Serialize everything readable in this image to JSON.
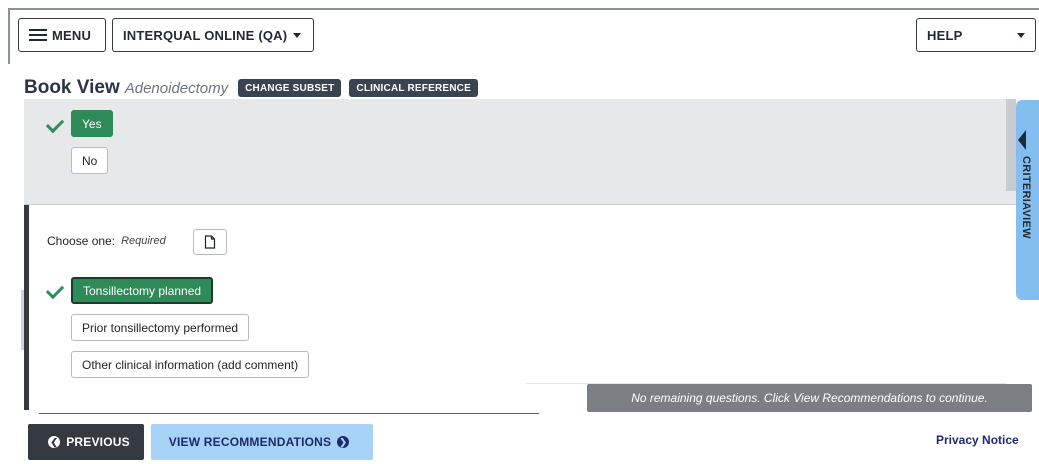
{
  "header": {
    "menu_label": "MENU",
    "product_label": "INTERQUAL ONLINE (QA)",
    "help_label": "HELP"
  },
  "title_row": {
    "title": "Book View",
    "subtitle": "Adenoidectomy",
    "change_subset_label": "CHANGE SUBSET",
    "clinical_reference_label": "CLINICAL REFERENCE"
  },
  "question1": {
    "options": [
      {
        "label": "Yes",
        "selected": true
      },
      {
        "label": "No",
        "selected": false
      }
    ]
  },
  "question2": {
    "prompt": "Choose one:",
    "required_label": "Required",
    "options": [
      {
        "label": "Tonsillectomy planned",
        "selected": true
      },
      {
        "label": "Prior tonsillectomy performed",
        "selected": false
      },
      {
        "label": "Other clinical information (add comment)",
        "selected": false
      }
    ]
  },
  "notice_text": "No remaining questions. Click View Recommendations to continue.",
  "criteria_tab_label": "CRITERIAVIEW",
  "footer": {
    "previous_label": "PREVIOUS",
    "view_recommendations_label": "VIEW RECOMMENDATIONS",
    "privacy_label": "Privacy Notice"
  },
  "colors": {
    "selected_green": "#2e8a58",
    "dark_button": "#343a40",
    "accent_blue": "#a6d2f5",
    "criteria_tab_blue": "#84bef1"
  },
  "icons": {
    "menu": "hamburger-icon",
    "dropdown": "caret-down-icon",
    "check": "checkmark-icon",
    "comment": "document-icon",
    "criteria_toggle": "chevron-left-icon",
    "previous": "arrow-left-circle-icon",
    "next": "arrow-right-circle-icon"
  }
}
